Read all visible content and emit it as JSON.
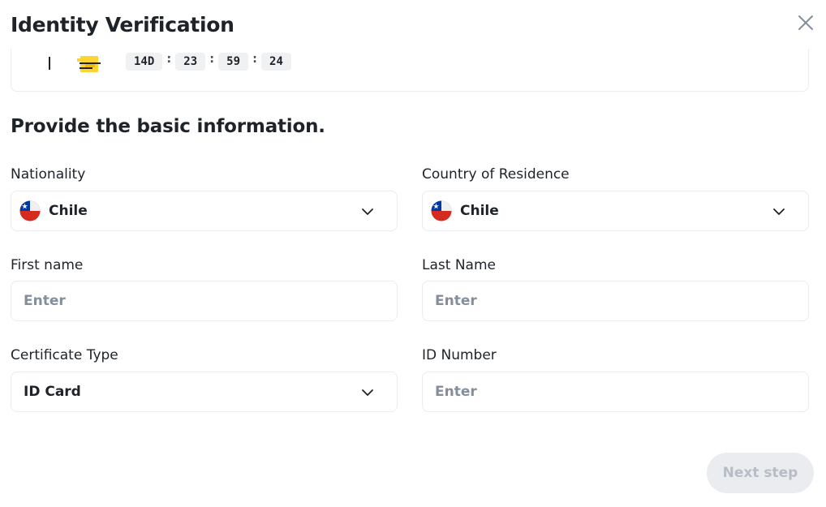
{
  "modal": {
    "title": "Identity Verification",
    "close_icon": "close-icon"
  },
  "timer": {
    "icon": "coupon-icon",
    "days": "14D",
    "hours": "23",
    "minutes": "59",
    "seconds": "24",
    "separator": ":"
  },
  "form": {
    "heading": "Provide the basic information.",
    "nationality": {
      "label": "Nationality",
      "value": "Chile",
      "icon": "chile-flag-icon"
    },
    "residence": {
      "label": "Country of Residence",
      "value": "Chile",
      "icon": "chile-flag-icon"
    },
    "first_name": {
      "label": "First name",
      "placeholder": "Enter",
      "value": ""
    },
    "last_name": {
      "label": "Last Name",
      "placeholder": "Enter",
      "value": ""
    },
    "certificate_type": {
      "label": "Certificate Type",
      "value": "ID Card"
    },
    "id_number": {
      "label": "ID Number",
      "placeholder": "Enter",
      "value": ""
    },
    "chevron_icon": "chevron-down-icon"
  },
  "footer": {
    "next_label": "Next step"
  },
  "colors": {
    "text": "#1e2329",
    "placeholder": "#848e9c",
    "border": "#eaecef",
    "disabled_bg": "#eaecef",
    "disabled_text": "#b7bdc6",
    "accent": "#fcd535"
  }
}
